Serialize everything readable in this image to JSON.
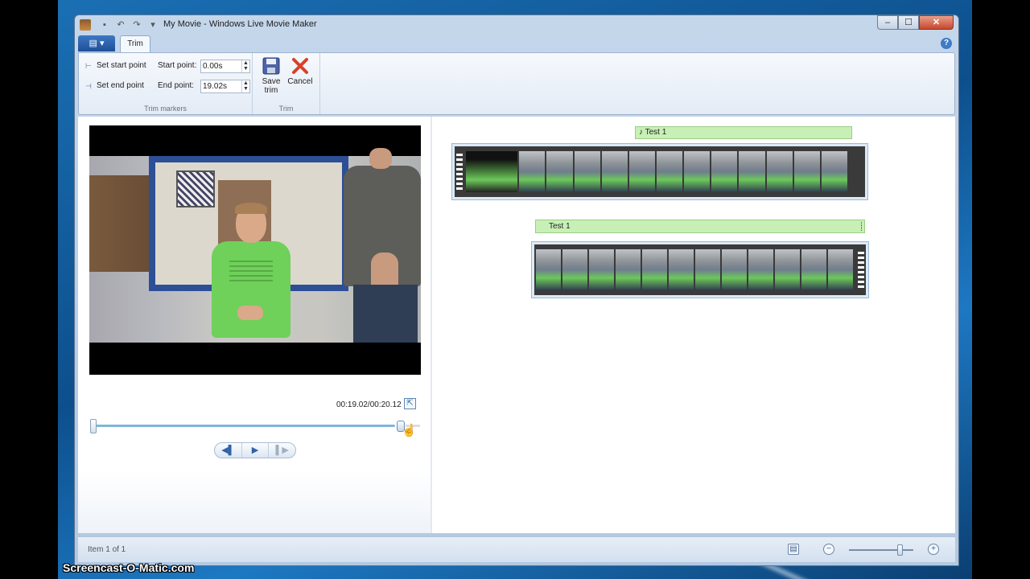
{
  "window": {
    "title": "My Movie - Windows Live Movie Maker",
    "min": "–",
    "max": "☐",
    "close": "✕"
  },
  "ribbon": {
    "app_menu_icon": "▤ ▾",
    "tab_trim": "Trim",
    "help": "?",
    "set_start_point": "Set start point",
    "set_end_point": "Set end point",
    "start_point_label": "Start point:",
    "start_point_value": "0.00s",
    "end_point_label": "End point:",
    "end_point_value": "19.02s",
    "trim_markers_group": "Trim markers",
    "save_trim_line1": "Save",
    "save_trim_line2": "trim",
    "cancel": "Cancel",
    "trim_group": "Trim"
  },
  "preview": {
    "timecode": "00:19.02/00:20.12",
    "seek_progress": 0.945,
    "transport": [
      "◀▌",
      "▶",
      "▌▶"
    ]
  },
  "storyboard": {
    "audio_clip_label": "Test 1",
    "video_clip_label": "Test 1"
  },
  "status": {
    "item_text": "Item 1 of 1",
    "zoom_out": "−",
    "zoom_in": "+"
  },
  "watermark": "Screencast-O-Matic.com",
  "colors": {
    "ribbon_accent": "#1f4f96",
    "clip_label_green": "#c8f0b6",
    "cancel_red": "#d9412a"
  },
  "icons": {
    "save": "save-icon",
    "cancel": "cancel-icon",
    "music": "music-note-icon",
    "expand": "expand-icon",
    "storyboard_view": "storyboard-view-icon"
  }
}
